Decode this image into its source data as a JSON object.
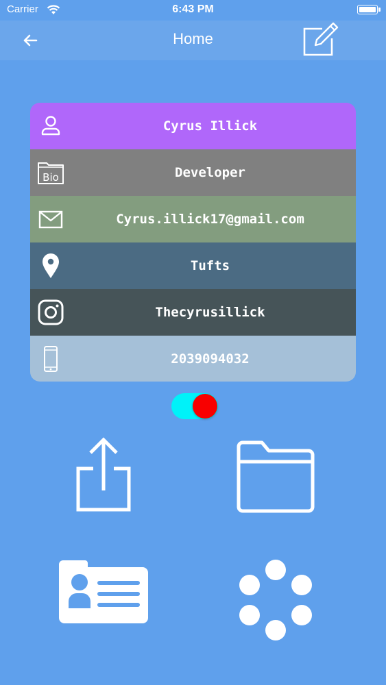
{
  "status_bar": {
    "carrier": "Carrier",
    "time": "6:43 PM"
  },
  "nav": {
    "title": "Home",
    "back_icon": "arrow-left-icon",
    "edit_icon": "edit-note-icon"
  },
  "profile": {
    "rows": [
      {
        "icon": "person-icon",
        "text": "Cyrus Illick",
        "color": "#b067fa"
      },
      {
        "icon": "bio-folder-icon",
        "icon_label": "Bio",
        "text": "Developer",
        "color": "#808080"
      },
      {
        "icon": "mail-icon",
        "text": "Cyrus.illick17@gmail.com",
        "color": "#839d7f"
      },
      {
        "icon": "location-pin-icon",
        "text": "Tufts",
        "color": "#4b6b83"
      },
      {
        "icon": "instagram-icon",
        "text": "Thecyrusillick",
        "color": "#465458"
      },
      {
        "icon": "phone-icon",
        "text": "2039094032",
        "color": "#a5c0d8"
      }
    ]
  },
  "toggle": {
    "on": true,
    "track_color": "#00f2f9",
    "knob_color": "#f80000"
  },
  "actions": [
    {
      "icon": "share-icon"
    },
    {
      "icon": "folder-icon"
    },
    {
      "icon": "contact-card-icon"
    },
    {
      "icon": "loading-dots-icon"
    }
  ],
  "colors": {
    "background": "#5fa0ec",
    "nav_bar": "#6ba6eb"
  }
}
